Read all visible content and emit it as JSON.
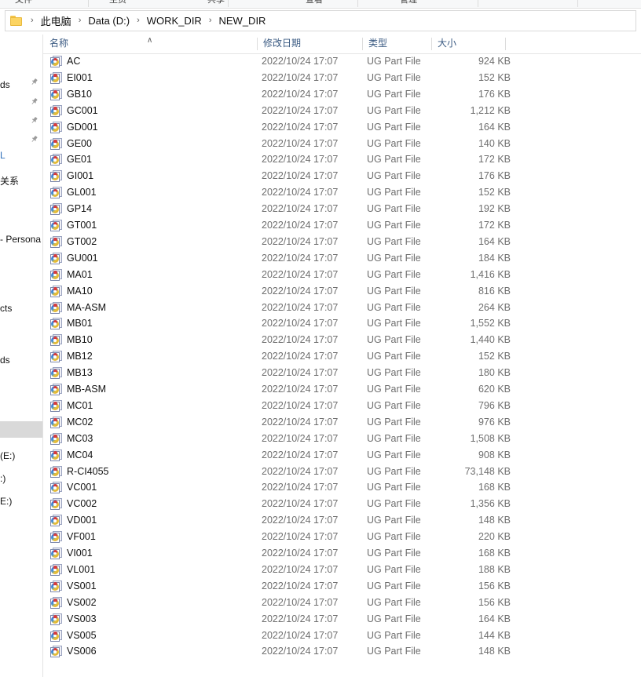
{
  "window": {
    "title": "NEW_DIR"
  },
  "ribbon": {
    "items": [
      "文件",
      "主页",
      "共享",
      "查看",
      "管理"
    ]
  },
  "address_bar": {
    "folder_icon": "folder-icon",
    "separator": "›",
    "crumbs": [
      "此电脑",
      "Data (D:)",
      "WORK_DIR",
      "NEW_DIR"
    ]
  },
  "nav_pane": {
    "pin_icon": "pin-icon",
    "items": [
      {
        "label": "ds",
        "pin": true,
        "color": "dark",
        "selected": false
      },
      {
        "label": "L",
        "pin": false,
        "color": "blue",
        "selected": false
      },
      {
        "label": "关系",
        "pin": false,
        "color": "dark",
        "selected": false
      },
      {
        "label": "- Persona",
        "pin": false,
        "color": "dark",
        "selected": false
      },
      {
        "label": "cts",
        "pin": false,
        "color": "dark",
        "selected": false
      },
      {
        "label": "ds",
        "pin": false,
        "color": "dark",
        "selected": false
      },
      {
        "label": "",
        "pin": false,
        "color": "dark",
        "selected": true
      },
      {
        "label": "(E:)",
        "pin": false,
        "color": "dark",
        "selected": false
      },
      {
        "label": ":)",
        "pin": false,
        "color": "dark",
        "selected": false
      },
      {
        "label": "E:)",
        "pin": false,
        "color": "dark",
        "selected": false
      }
    ]
  },
  "file_list": {
    "columns": [
      {
        "key": "name",
        "label": "名称",
        "sorted": true,
        "sort_caret": "∧"
      },
      {
        "key": "date",
        "label": "修改日期",
        "sorted": false
      },
      {
        "key": "type",
        "label": "类型",
        "sorted": false
      },
      {
        "key": "size",
        "label": "大小",
        "sorted": false
      }
    ],
    "icon": "ug-part-file-icon",
    "rows": [
      {
        "name": "AC",
        "date": "2022/10/24 17:07",
        "type": "UG Part File",
        "size": "924 KB"
      },
      {
        "name": "EI001",
        "date": "2022/10/24 17:07",
        "type": "UG Part File",
        "size": "152 KB"
      },
      {
        "name": "GB10",
        "date": "2022/10/24 17:07",
        "type": "UG Part File",
        "size": "176 KB"
      },
      {
        "name": "GC001",
        "date": "2022/10/24 17:07",
        "type": "UG Part File",
        "size": "1,212 KB"
      },
      {
        "name": "GD001",
        "date": "2022/10/24 17:07",
        "type": "UG Part File",
        "size": "164 KB"
      },
      {
        "name": "GE00",
        "date": "2022/10/24 17:07",
        "type": "UG Part File",
        "size": "140 KB"
      },
      {
        "name": "GE01",
        "date": "2022/10/24 17:07",
        "type": "UG Part File",
        "size": "172 KB"
      },
      {
        "name": "GI001",
        "date": "2022/10/24 17:07",
        "type": "UG Part File",
        "size": "176 KB"
      },
      {
        "name": "GL001",
        "date": "2022/10/24 17:07",
        "type": "UG Part File",
        "size": "152 KB"
      },
      {
        "name": "GP14",
        "date": "2022/10/24 17:07",
        "type": "UG Part File",
        "size": "192 KB"
      },
      {
        "name": "GT001",
        "date": "2022/10/24 17:07",
        "type": "UG Part File",
        "size": "172 KB"
      },
      {
        "name": "GT002",
        "date": "2022/10/24 17:07",
        "type": "UG Part File",
        "size": "164 KB"
      },
      {
        "name": "GU001",
        "date": "2022/10/24 17:07",
        "type": "UG Part File",
        "size": "184 KB"
      },
      {
        "name": "MA01",
        "date": "2022/10/24 17:07",
        "type": "UG Part File",
        "size": "1,416 KB"
      },
      {
        "name": "MA10",
        "date": "2022/10/24 17:07",
        "type": "UG Part File",
        "size": "816 KB"
      },
      {
        "name": "MA-ASM",
        "date": "2022/10/24 17:07",
        "type": "UG Part File",
        "size": "264 KB"
      },
      {
        "name": "MB01",
        "date": "2022/10/24 17:07",
        "type": "UG Part File",
        "size": "1,552 KB"
      },
      {
        "name": "MB10",
        "date": "2022/10/24 17:07",
        "type": "UG Part File",
        "size": "1,440 KB"
      },
      {
        "name": "MB12",
        "date": "2022/10/24 17:07",
        "type": "UG Part File",
        "size": "152 KB"
      },
      {
        "name": "MB13",
        "date": "2022/10/24 17:07",
        "type": "UG Part File",
        "size": "180 KB"
      },
      {
        "name": "MB-ASM",
        "date": "2022/10/24 17:07",
        "type": "UG Part File",
        "size": "620 KB"
      },
      {
        "name": "MC01",
        "date": "2022/10/24 17:07",
        "type": "UG Part File",
        "size": "796 KB"
      },
      {
        "name": "MC02",
        "date": "2022/10/24 17:07",
        "type": "UG Part File",
        "size": "976 KB"
      },
      {
        "name": "MC03",
        "date": "2022/10/24 17:07",
        "type": "UG Part File",
        "size": "1,508 KB"
      },
      {
        "name": "MC04",
        "date": "2022/10/24 17:07",
        "type": "UG Part File",
        "size": "908 KB"
      },
      {
        "name": "R-CI4055",
        "date": "2022/10/24 17:07",
        "type": "UG Part File",
        "size": "73,148 KB"
      },
      {
        "name": "VC001",
        "date": "2022/10/24 17:07",
        "type": "UG Part File",
        "size": "168 KB"
      },
      {
        "name": "VC002",
        "date": "2022/10/24 17:07",
        "type": "UG Part File",
        "size": "1,356 KB"
      },
      {
        "name": "VD001",
        "date": "2022/10/24 17:07",
        "type": "UG Part File",
        "size": "148 KB"
      },
      {
        "name": "VF001",
        "date": "2022/10/24 17:07",
        "type": "UG Part File",
        "size": "220 KB"
      },
      {
        "name": "VI001",
        "date": "2022/10/24 17:07",
        "type": "UG Part File",
        "size": "168 KB"
      },
      {
        "name": "VL001",
        "date": "2022/10/24 17:07",
        "type": "UG Part File",
        "size": "188 KB"
      },
      {
        "name": "VS001",
        "date": "2022/10/24 17:07",
        "type": "UG Part File",
        "size": "156 KB"
      },
      {
        "name": "VS002",
        "date": "2022/10/24 17:07",
        "type": "UG Part File",
        "size": "156 KB"
      },
      {
        "name": "VS003",
        "date": "2022/10/24 17:07",
        "type": "UG Part File",
        "size": "164 KB"
      },
      {
        "name": "VS005",
        "date": "2022/10/24 17:07",
        "type": "UG Part File",
        "size": "144 KB"
      },
      {
        "name": "VS006",
        "date": "2022/10/24 17:07",
        "type": "UG Part File",
        "size": "148 KB"
      }
    ]
  },
  "colors": {
    "header_text": "#3a5a82",
    "secondary_text": "#6e6e6e",
    "selection": "#d9d9d9",
    "link_blue": "#2f6fba"
  }
}
